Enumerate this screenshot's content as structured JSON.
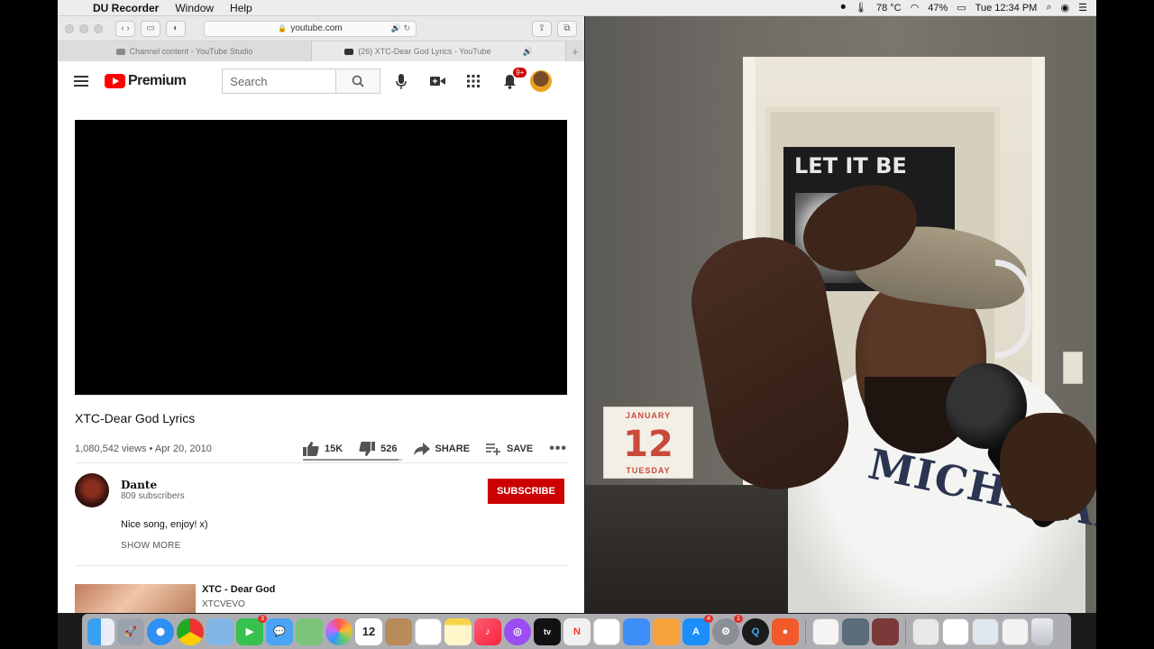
{
  "menubar": {
    "app_name": "DU Recorder",
    "menus": [
      "Window",
      "Help"
    ],
    "temperature": "78 °C",
    "battery": "47%",
    "clock": "Tue 12:34 PM"
  },
  "browser": {
    "url": "youtube.com",
    "tabs": [
      {
        "label": "Channel content - YouTube Studio"
      },
      {
        "label": "(26) XTC-Dear God Lyrics - YouTube"
      }
    ]
  },
  "youtube": {
    "brand": "Premium",
    "search_placeholder": "Search",
    "notification_count": "9+",
    "video": {
      "title": "XTC-Dear God Lyrics",
      "views_date": "1,080,542 views • Apr 20, 2010",
      "likes": "15K",
      "dislikes": "526",
      "share_label": "SHARE",
      "save_label": "SAVE",
      "like_ratio": 0.966
    },
    "channel": {
      "name": "Dante",
      "subscribers": "809 subscribers",
      "subscribe_label": "SUBSCRIBE"
    },
    "description": "Nice song, enjoy! x)",
    "show_more": "SHOW MORE",
    "recommended": [
      {
        "title": "XTC - Dear God",
        "channel": "XTCVEVO"
      }
    ]
  },
  "webcam": {
    "poster_text": "LET IT BE",
    "calendar_month": "JANUARY",
    "calendar_day": "12",
    "calendar_weekday": "TUESDAY",
    "shirt_text": "MICHIGAN"
  },
  "dock": {
    "calendar_day": "12",
    "badges": {
      "facetime": "3",
      "appstore": "4",
      "sysprefs": "1"
    }
  }
}
